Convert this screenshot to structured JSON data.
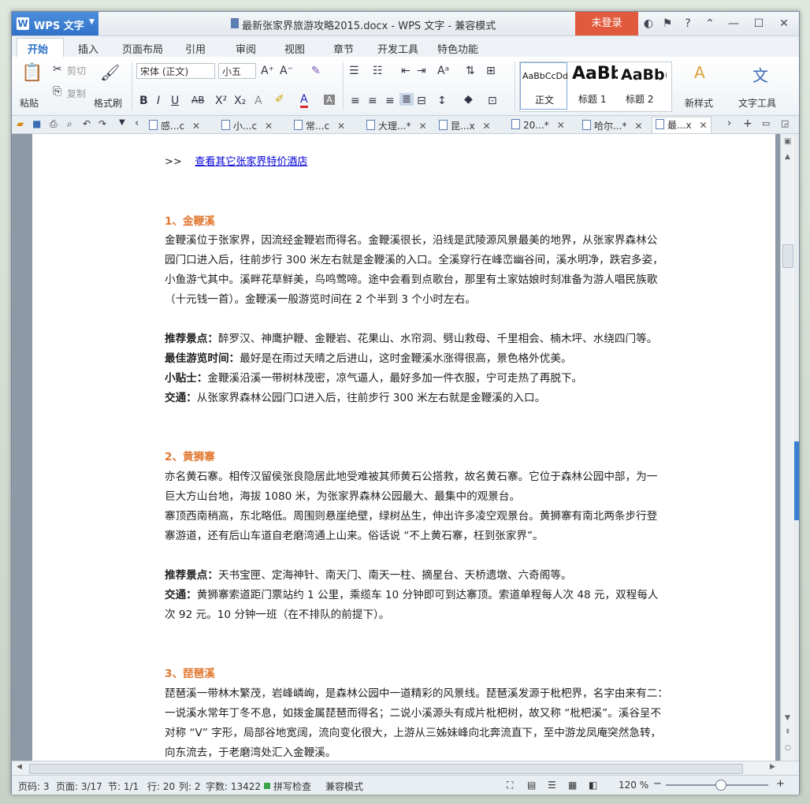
{
  "app": {
    "name": "WPS 文字",
    "login": "未登录"
  },
  "title": "最新张家界旅游攻略2015.docx - WPS 文字 - 兼容模式",
  "ribbon_tabs": [
    "开始",
    "插入",
    "页面布局",
    "引用",
    "审阅",
    "视图",
    "章节",
    "开发工具",
    "特色功能"
  ],
  "ribbon": {
    "paste": "粘贴",
    "cut": "剪切",
    "copy": "复制",
    "format_painter": "格式刷",
    "font_name": "宋体 (正文)",
    "font_size": "小五",
    "styles": [
      {
        "sample": "AaBbCcDd",
        "name": "正文"
      },
      {
        "sample": "AaBb",
        "name": "标题 1"
      },
      {
        "sample": "AaBb(",
        "name": "标题 2"
      }
    ],
    "new_style": "新样式",
    "text_tools": "文字工具"
  },
  "doc_tabs": [
    "感...c",
    "小...c",
    "常...c",
    "大理...*",
    "昆...x",
    "20...*",
    "哈尔...*",
    "最...x"
  ],
  "document": {
    "link_prefix": ">>",
    "link": "查看其它张家界特价酒店",
    "s1_title": "1、金鞭溪",
    "s1_p": [
      "金鞭溪位于张家界，因流经金鞭岩而得名。金鞭溪很长，沿线是武陵源风景最美的地界，从张家界森林公",
      "园门口进入后，往前步行 300 米左右就是金鞭溪的入口。全溪穿行在峰峦幽谷间，溪水明净，跌宕多姿，",
      "小鱼游弋其中。溪畔花草鲜美，鸟鸣莺啼。途中会看到点歌台，那里有土家姑娘时刻准备为游人唱民族歌",
      "（十元钱一首）。金鞭溪一般游览时间在 2 个半到 3 个小时左右。"
    ],
    "s1_info": [
      {
        "k": "推荐景点：",
        "v": "醉罗汉、神鹰护鞭、金鞭岩、花果山、水帘洞、劈山救母、千里相会、楠木坪、水绕四门等。"
      },
      {
        "k": "最佳游览时间：",
        "v": "最好是在雨过天晴之后进山，这时金鞭溪水涨得很高，景色格外优美。"
      },
      {
        "k": "小贴士：",
        "v": "金鞭溪沿溪一带树林茂密，凉气逼人，最好多加一件衣服，宁可走热了再脱下。"
      },
      {
        "k": "交通：",
        "v": "从张家界森林公园门口进入后，往前步行 300 米左右就是金鞭溪的入口。"
      }
    ],
    "s2_title": "2、黄狮寨",
    "s2_p": [
      "亦名黄石寨。相传汉留侯张良隐居此地受难被其师黄石公搭救，故名黄石寨。它位于森林公园中部，为一",
      "巨大方山台地，海拔 1080 米，为张家界森林公园最大、最集中的观景台。",
      "寨顶西南稍高，东北略低。周围则悬崖绝壁，绿树丛生，伸出许多凌空观景台。黄狮寨有南北两条步行登",
      "寨游道，还有后山车道自老磨湾通上山来。俗话说 “不上黄石寨，枉到张家界”。"
    ],
    "s2_info": [
      {
        "k": "推荐景点：",
        "v": "天书宝匣、定海神针、南天门、南天一柱、摘星台、天桥遗墩、六奇阁等。"
      },
      {
        "k": "交通：",
        "v": "黄狮寨索道距门票站约 1 公里，乘缆车 10 分钟即可到达寨顶。索道单程每人次 48 元，双程每人"
      }
    ],
    "s2_info_cont": "次 92 元。10 分钟一班（在不排队的前提下）。",
    "s3_title": "3、琵琶溪",
    "s3_p": [
      "琵琶溪一带林木繁茂，岩峰嶙峋，是森林公园中一道精彩的风景线。琵琶溪发源于枇杷界，名字由来有二：",
      "一说溪水常年丁冬不息，如拨金属琵琶而得名；二说小溪源头有成片枇杷树，故又称 “枇杷溪”。溪谷呈不",
      "对称 “V” 字形，局部谷地宽阔，流向变化很大，上游从三姊妹峰向北奔流直下，至中游龙凤庵突然急转，",
      "向东流去，于老磨湾处汇入金鞭溪。"
    ]
  },
  "status": {
    "page_code": "页码: 3",
    "page": "页面: 3/17",
    "section": "节: 1/1",
    "row": "行: 20",
    "col": "列: 2",
    "words": "字数: 13422",
    "spell": "拼写检查",
    "compat": "兼容模式",
    "zoom": "120 %"
  },
  "colors": {
    "heading": "#e0772f",
    "link": "#0000d8",
    "login": "#e25a3d",
    "app": "#2f72c8"
  }
}
